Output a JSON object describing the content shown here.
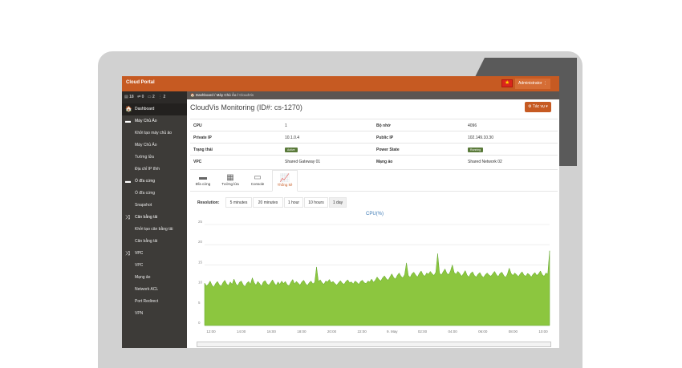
{
  "app": {
    "brand": "Cloud Portal",
    "user": "Administrator"
  },
  "counters": [
    "18",
    "0",
    "2",
    "2"
  ],
  "sidebar": {
    "items": [
      {
        "label": "Dashboard",
        "icon": "home-icon",
        "level": "parent",
        "active": true
      },
      {
        "label": "Máy Chủ Ảo",
        "icon": "server-icon",
        "level": "parent"
      },
      {
        "label": "Khởi tạo máy chủ ảo",
        "level": "child"
      },
      {
        "label": "Máy Chủ Ảo",
        "level": "child"
      },
      {
        "label": "Tường lửa",
        "level": "child"
      },
      {
        "label": "Địa chỉ IP tĩnh",
        "level": "child"
      },
      {
        "label": "Ổ đĩa cứng",
        "icon": "disk-icon",
        "level": "parent"
      },
      {
        "label": "Ổ đĩa cứng",
        "level": "child"
      },
      {
        "label": "Snapshot",
        "level": "child"
      },
      {
        "label": "Cân bằng tải",
        "icon": "shuffle-icon",
        "level": "parent"
      },
      {
        "label": "Khởi tạo cân bằng tải",
        "level": "child"
      },
      {
        "label": "Cân bằng tải",
        "level": "child"
      },
      {
        "label": "VPC",
        "icon": "shuffle-icon",
        "level": "parent"
      },
      {
        "label": "VPC",
        "level": "child"
      },
      {
        "label": "Mạng ảo",
        "level": "child"
      },
      {
        "label": "Network ACL",
        "level": "child"
      },
      {
        "label": "Port Redirect",
        "level": "child"
      },
      {
        "label": "VPN",
        "level": "child"
      }
    ]
  },
  "breadcrumb": {
    "home": "Dashboard",
    "middle": "Máy Chủ Ảo",
    "current": "CloudVis"
  },
  "page": {
    "title": "CloudVis Monitoring (ID#: cs-1270)",
    "actions_label": "Tác vụ"
  },
  "info": [
    {
      "k1": "CPU",
      "v1": "1",
      "k2": "Bộ nhớ",
      "v2": "4096"
    },
    {
      "k1": "Private IP",
      "v1": "10.1.0.4",
      "k2": "Public IP",
      "v2": "102.149.10.30"
    },
    {
      "k1": "Trạng thái",
      "v1": "Active",
      "k2": "Power State",
      "v2": "Running"
    },
    {
      "k1": "VPC",
      "v1": "Shared Gateway 01",
      "k2": "Mạng ảo",
      "v2": "Shared Network 02"
    }
  ],
  "tabs": [
    {
      "label": "Đĩa cứng",
      "icon": "disk-icon"
    },
    {
      "label": "Tường lửa",
      "icon": "firewall-icon"
    },
    {
      "label": "Console",
      "icon": "monitor-icon"
    },
    {
      "label": "Thống kê",
      "icon": "chart-icon",
      "active": true
    }
  ],
  "resolution": {
    "label": "Resolution:",
    "options": [
      "5 minutes",
      "20 minutes",
      "1 hour",
      "10 hours",
      "1 day"
    ],
    "selected": "1 day"
  },
  "colors": {
    "accent": "#c65a22",
    "area": "#8cc63f",
    "area_line": "#5fa52a",
    "sidebar": "#3d3b38"
  },
  "chart_data": {
    "type": "area",
    "title": "CPU(%)",
    "ylim": [
      0,
      25
    ],
    "yticks": [
      0,
      5,
      10,
      15,
      20,
      25
    ],
    "x_ticks": [
      "12:00",
      "14:00",
      "16:00",
      "18:00",
      "20:00",
      "22:00",
      "9. May",
      "02:00",
      "04:00",
      "06:00",
      "08:00",
      "10:00"
    ],
    "series": [
      {
        "values": [
          10.5,
          9.8,
          10.2,
          11.0,
          10.0,
          9.5,
          10.4,
          10.9,
          10.1,
          9.7,
          10.6,
          11.2,
          10.3,
          9.9,
          10.8,
          10.2,
          11.5,
          10.4,
          9.8,
          10.7,
          11.0,
          10.1,
          9.6,
          10.5,
          10.9,
          10.2,
          11.8,
          10.6,
          10.0,
          10.9,
          10.4,
          9.7,
          10.8,
          11.1,
          10.3,
          10.0,
          10.6,
          11.3,
          10.5,
          9.9,
          10.8,
          10.2,
          11.0,
          10.4,
          10.9,
          10.1,
          9.8,
          10.7,
          11.4,
          10.3,
          10.9,
          10.5,
          10.0,
          10.8,
          11.2,
          10.4,
          9.9,
          10.6,
          11.0,
          10.3,
          10.7,
          14.5,
          10.9,
          11.3,
          10.6,
          10.2,
          11.0,
          10.8,
          11.4,
          10.6,
          10.9,
          10.4,
          10.0,
          10.6,
          11.1,
          10.5,
          10.2,
          10.9,
          11.3,
          10.6,
          10.8,
          10.3,
          11.0,
          10.7,
          10.2,
          10.9,
          11.2,
          10.6,
          10.4,
          11.0,
          10.8,
          11.5,
          10.7,
          11.2,
          12.0,
          11.4,
          11.0,
          11.8,
          12.3,
          11.6,
          11.2,
          12.0,
          12.8,
          11.9,
          11.5,
          12.4,
          13.0,
          12.2,
          11.8,
          12.6,
          15.5,
          12.4,
          11.9,
          12.8,
          13.2,
          12.5,
          12.0,
          12.9,
          13.5,
          12.6,
          12.2,
          13.0,
          12.7,
          13.4,
          12.8,
          12.4,
          13.2,
          17.8,
          13.0,
          12.5,
          13.3,
          14.0,
          12.9,
          12.6,
          13.5,
          15.0,
          13.1,
          12.7,
          13.4,
          12.9,
          12.2,
          12.8,
          13.6,
          12.5,
          12.0,
          12.9,
          13.3,
          12.4,
          12.0,
          12.7,
          13.1,
          12.3,
          11.9,
          12.6,
          13.0,
          12.5,
          12.2,
          12.8,
          13.4,
          12.6,
          12.1,
          12.9,
          13.2,
          12.4,
          11.9,
          12.7,
          14.2,
          12.9,
          12.4,
          13.0,
          12.6,
          12.1,
          12.8,
          13.3,
          12.5,
          12.2,
          12.9,
          12.6,
          12.0,
          12.7,
          13.1,
          12.4,
          12.8,
          13.5,
          12.6,
          12.2,
          13.0,
          12.7,
          18.5
        ]
      }
    ]
  }
}
